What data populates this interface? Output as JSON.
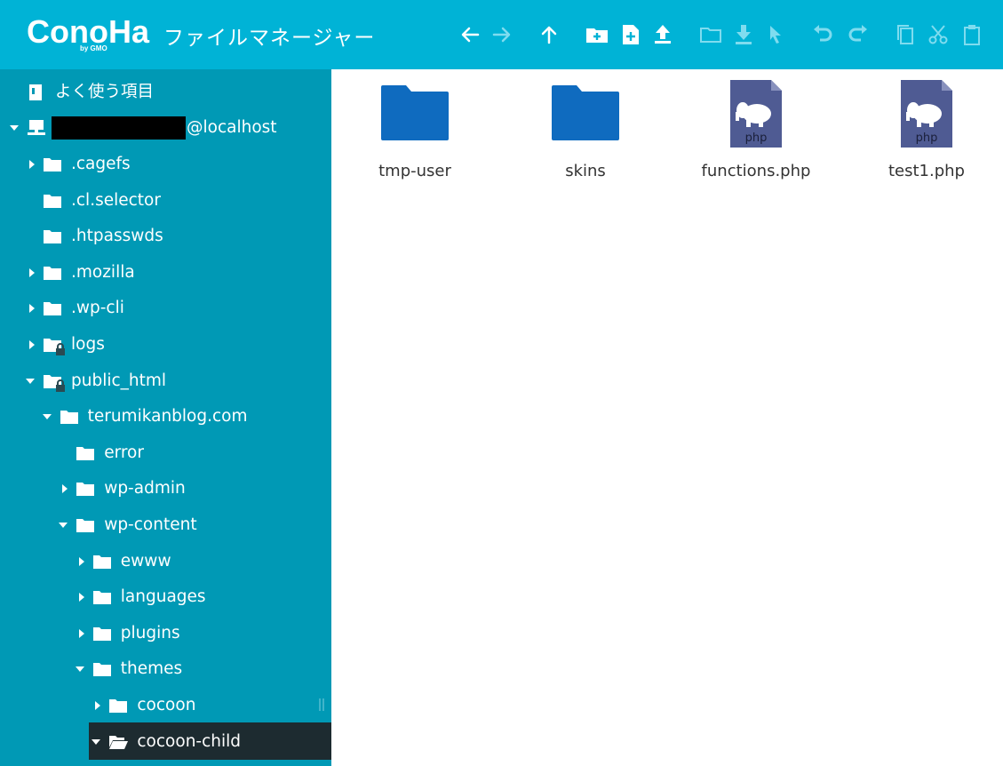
{
  "app": {
    "logo_text": "ConoHa",
    "logo_sub": "by GMO",
    "title": "ファイルマネージャー"
  },
  "toolbar": {
    "buttons": [
      {
        "name": "back-icon",
        "enabled": true
      },
      {
        "name": "forward-icon",
        "enabled": false
      },
      {
        "name": "up-icon",
        "enabled": true
      },
      {
        "name": "new-folder-icon",
        "enabled": true
      },
      {
        "name": "new-file-icon",
        "enabled": true
      },
      {
        "name": "upload-icon",
        "enabled": true
      },
      {
        "name": "open-folder-icon",
        "enabled": false
      },
      {
        "name": "download-icon",
        "enabled": false
      },
      {
        "name": "select-icon",
        "enabled": false
      },
      {
        "name": "undo-icon",
        "enabled": false
      },
      {
        "name": "redo-icon",
        "enabled": false
      },
      {
        "name": "copy-icon",
        "enabled": false
      },
      {
        "name": "cut-icon",
        "enabled": false
      },
      {
        "name": "paste-icon",
        "enabled": false
      }
    ]
  },
  "sidebar": {
    "favorites": "よく使う項目",
    "host": "@localhost",
    "items": [
      {
        "label": ".cagefs",
        "caret": "right"
      },
      {
        "label": ".cl.selector",
        "caret": "none"
      },
      {
        "label": ".htpasswds",
        "caret": "none"
      },
      {
        "label": ".mozilla",
        "caret": "right"
      },
      {
        "label": ".wp-cli",
        "caret": "right"
      },
      {
        "label": "logs",
        "caret": "right",
        "locked": true
      },
      {
        "label": "public_html",
        "caret": "down",
        "locked": true
      },
      {
        "label": "terumikanblog.com",
        "caret": "down"
      },
      {
        "label": "error",
        "caret": "none"
      },
      {
        "label": "wp-admin",
        "caret": "right"
      },
      {
        "label": "wp-content",
        "caret": "down"
      },
      {
        "label": "ewww",
        "caret": "right"
      },
      {
        "label": "languages",
        "caret": "right"
      },
      {
        "label": "plugins",
        "caret": "right"
      },
      {
        "label": "themes",
        "caret": "down"
      },
      {
        "label": "cocoon",
        "caret": "right"
      },
      {
        "label": "cocoon-child",
        "caret": "down",
        "selected": true
      }
    ]
  },
  "main": {
    "files": [
      {
        "name": "tmp-user",
        "type": "folder"
      },
      {
        "name": "skins",
        "type": "folder"
      },
      {
        "name": "functions.php",
        "type": "php",
        "badge": "php"
      },
      {
        "name": "test1.php",
        "type": "php",
        "badge": "php"
      }
    ]
  },
  "colors": {
    "header": "#00b3d6",
    "sidebar": "#0099b5",
    "selected": "#1d2b30",
    "folder": "#0f6bbf",
    "php": "#4f5b93"
  }
}
